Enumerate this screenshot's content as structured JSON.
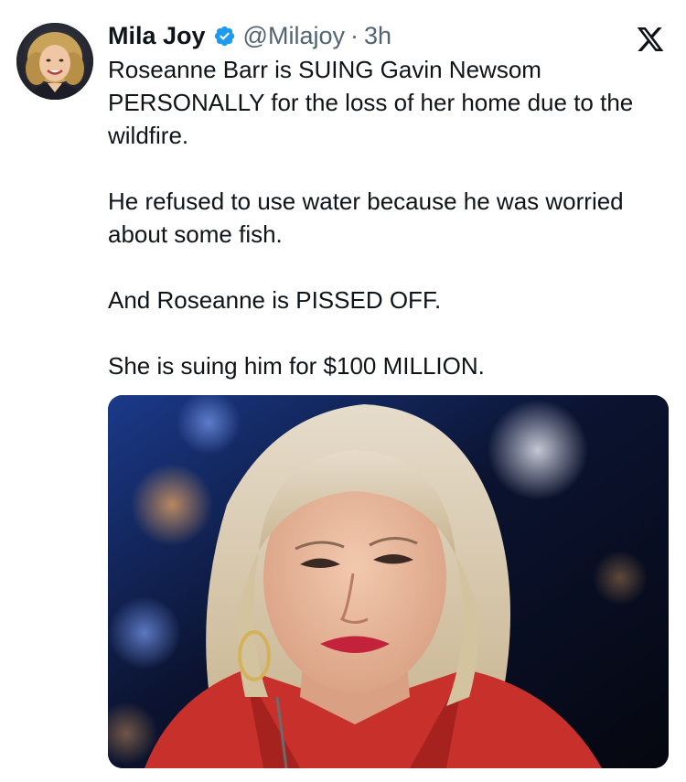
{
  "author": {
    "display_name": "Mila Joy",
    "handle": "@Milajoy",
    "separator": "·",
    "time": "3h",
    "verified": true,
    "verified_color": "#1d9bf0"
  },
  "tweet": {
    "paragraphs": [
      "Roseanne Barr is SUING Gavin Newsom PERSONALLY for the loss of her home due to the wildfire.",
      "He refused to use water because he was worried about some fish.",
      "And Roseanne is PISSED OFF.",
      "She is suing him for $100 MILLION."
    ]
  },
  "icons": {
    "platform_logo": "x-logo-icon",
    "badge": "verified-badge-icon"
  },
  "colors": {
    "text": "#0f1419",
    "secondary_text": "#536471",
    "accent": "#1d9bf0"
  }
}
